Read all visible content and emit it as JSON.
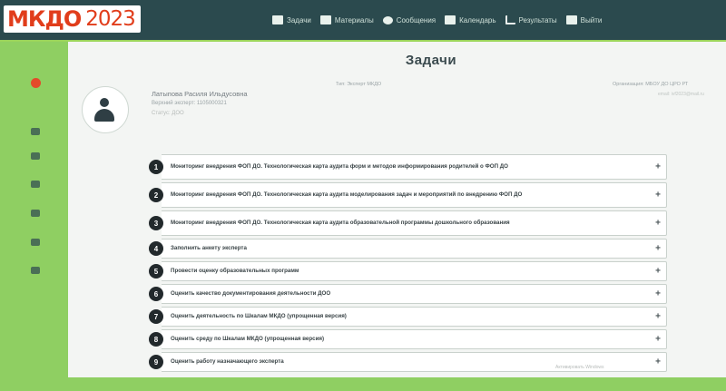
{
  "app": {
    "logo_main": "МКДО",
    "logo_year": "2023"
  },
  "nav": {
    "items": [
      {
        "label": "Задачи",
        "icon": "tasks-icon"
      },
      {
        "label": "Материалы",
        "icon": "list-icon"
      },
      {
        "label": "Сообщения",
        "icon": "message-icon"
      },
      {
        "label": "Календарь",
        "icon": "calendar-icon"
      },
      {
        "label": "Результаты",
        "icon": "chart-icon"
      },
      {
        "label": "Выйти",
        "icon": "logout-icon"
      }
    ]
  },
  "page": {
    "title": "Задачи"
  },
  "user": {
    "name": "Латыпова Расиля Ильдусовна",
    "meta": "Верхний эксперт: 1105000321",
    "meta2": "Статус: ДОО",
    "center_info": "Тип: Эксперт МКДО",
    "org_info": "Организация: МБОУ ДО ЦРО РТ",
    "org_info2": "email: ivf2023@mail.ru"
  },
  "tasks": [
    {
      "num": "1",
      "text": "Мониторинг внедрения ФОП ДО. Технологическая карта аудита форм и методов информирования родителей о ФОП ДО"
    },
    {
      "num": "2",
      "text": "Мониторинг внедрения ФОП ДО. Технологическая карта аудита моделирования задач и мероприятий по внедрению ФОП ДО"
    },
    {
      "num": "3",
      "text": "Мониторинг внедрения ФОП ДО. Технологическая карта аудита образовательной программы дошкольного образования"
    },
    {
      "num": "4",
      "text": "Заполнить анкету эксперта"
    },
    {
      "num": "5",
      "text": "Провести оценку образовательных программ"
    },
    {
      "num": "6",
      "text": "Оценить качество документирования деятельности ДОО"
    },
    {
      "num": "7",
      "text": "Оценить деятельность по Шкалам МКДО (упрощенная версия)"
    },
    {
      "num": "8",
      "text": "Оценить среду по Шкалам МКДО (упрощенная версия)"
    },
    {
      "num": "9",
      "text": "Оценить работу назначающего эксперта"
    }
  ],
  "footer": {
    "note": "Активировать Windows"
  },
  "colors": {
    "topbar": "#2b4a4e",
    "accent_green": "#8fcf62",
    "logo_red": "#e13d1b"
  }
}
